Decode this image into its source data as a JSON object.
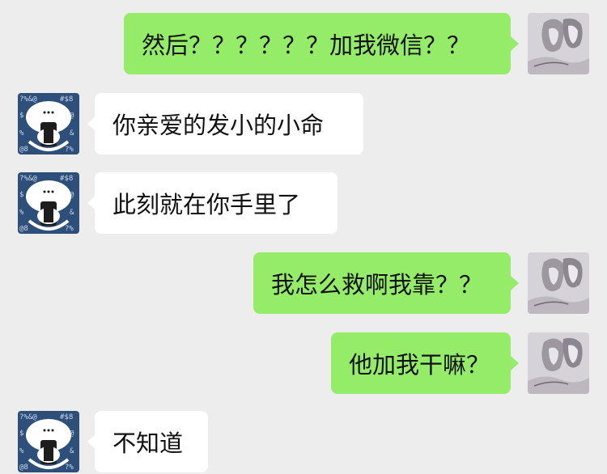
{
  "messages": [
    {
      "side": "out",
      "text": "然后？？？？？？加我微信？？"
    },
    {
      "side": "in",
      "text": "你亲爱的发小的小命"
    },
    {
      "side": "in",
      "text": "此刻就在你手里了"
    },
    {
      "side": "out",
      "text": "我怎么救啊我靠？？"
    },
    {
      "side": "out",
      "text": "他加我干嘛？"
    },
    {
      "side": "in",
      "text": "不知道"
    }
  ],
  "avatars": {
    "self": {
      "icon": "couple-sketch-avatar-icon"
    },
    "friend": {
      "icon": "cartoon-pig-avatar-icon"
    }
  },
  "colors": {
    "background": "#ededed",
    "outgoing_bubble": "#95ec69",
    "incoming_bubble": "#ffffff"
  }
}
